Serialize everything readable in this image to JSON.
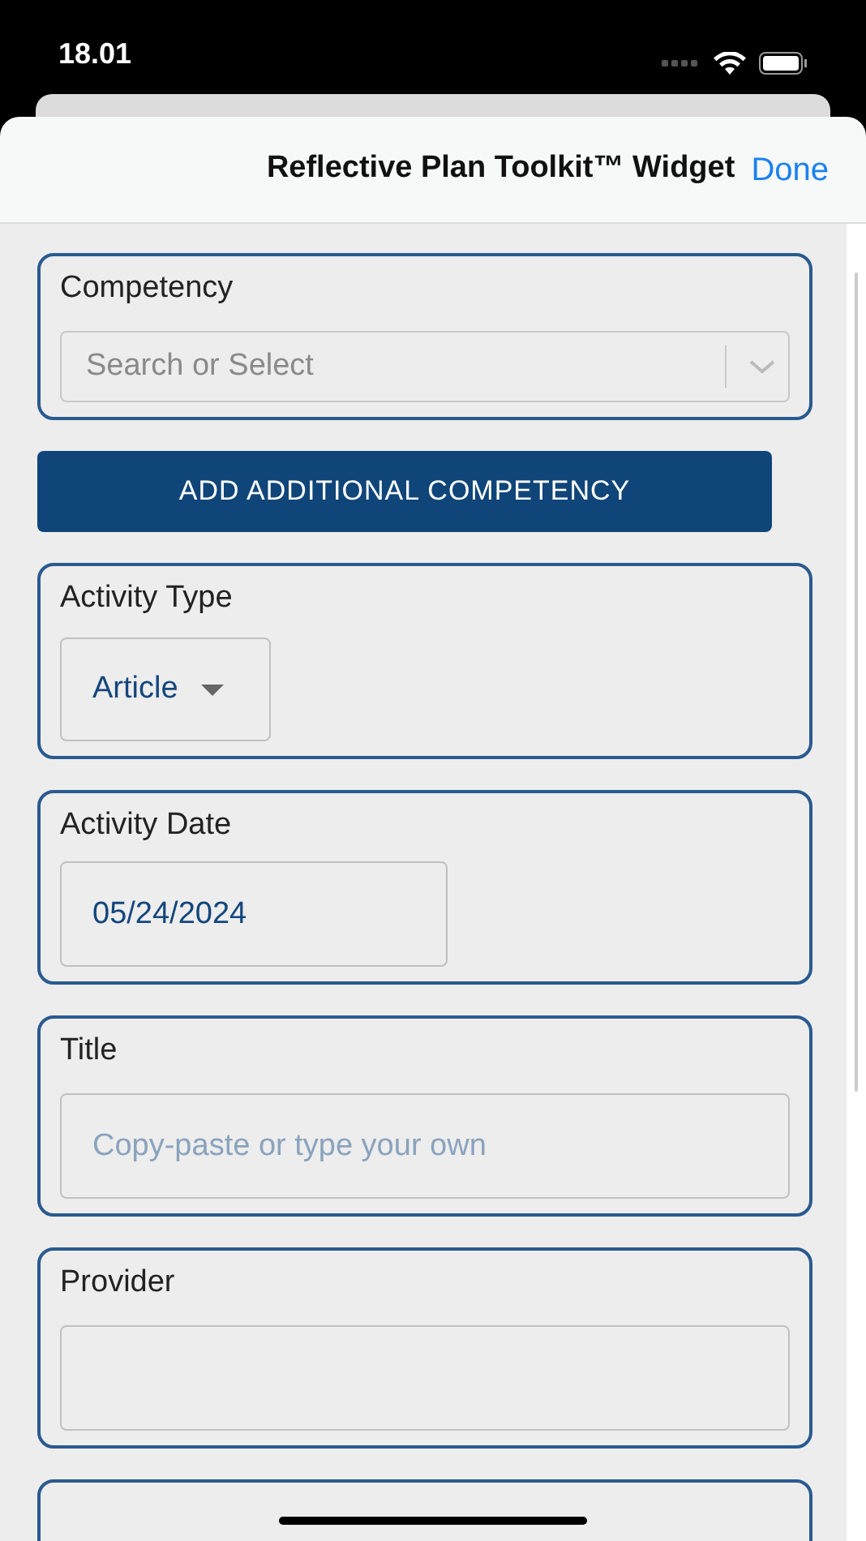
{
  "status_bar": {
    "time": "18.01"
  },
  "header": {
    "title": "Reflective Plan Toolkit™ Widget",
    "done": "Done"
  },
  "form": [
    {
      "kind": "combobox",
      "label": "Competency",
      "placeholder": "Search or Select"
    },
    {
      "kind": "button",
      "label": "ADD ADDITIONAL COMPETENCY"
    },
    {
      "kind": "dropdown",
      "label": "Activity Type",
      "value": "Article"
    },
    {
      "kind": "date",
      "label": "Activity Date",
      "value": "05/24/2024"
    },
    {
      "kind": "text",
      "label": "Title",
      "placeholder": "Copy-paste or type your own"
    },
    {
      "kind": "textarea",
      "label": "Provider"
    }
  ]
}
